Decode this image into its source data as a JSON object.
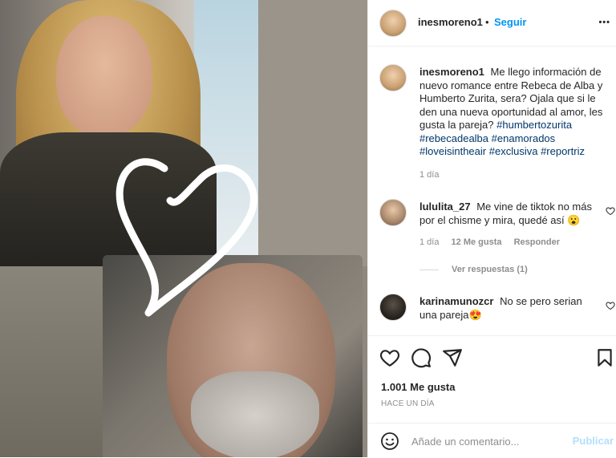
{
  "post": {
    "author": "inesmoreno1",
    "separator": "•",
    "follow_label": "Seguir",
    "more_label": "•••"
  },
  "caption": {
    "username": "inesmoreno1",
    "text": "Me llego información de nuevo romance entre Rebeca de Alba y Humberto Zurita, sera? Ojala que si le den una nueva oportunidad al amor, les gusta la pareja?",
    "hashtags": [
      "#humbertozurita",
      "#rebecadealba",
      "#enamorados",
      "#loveisintheair",
      "#exclusiva",
      "#reportriz"
    ],
    "time": "1 día"
  },
  "comments": [
    {
      "username": "lululita_27",
      "text": "Me vine de tiktok no más por el chisme y mira, quedé así 😮",
      "time": "1 día",
      "likes": "12 Me gusta",
      "reply_label": "Responder"
    },
    {
      "username": "karinamunozcr",
      "text": "No se pero serian una pareja😍"
    }
  ],
  "view_replies": "Ver respuestas (1)",
  "likes_label": "1.001 Me gusta",
  "date_label": "HACE UN DÍA",
  "add_comment": {
    "placeholder": "Añade un comentario...",
    "publish_label": "Publicar"
  },
  "icons": {
    "like": "heart-outline-icon",
    "comment": "comment-bubble-icon",
    "share": "paper-plane-icon",
    "save": "bookmark-icon",
    "emoji": "smiley-icon"
  },
  "colors": {
    "link": "#0095f6",
    "hashtag": "#00376b",
    "muted": "#8e8e8e",
    "publish_disabled": "#b2dffc"
  }
}
